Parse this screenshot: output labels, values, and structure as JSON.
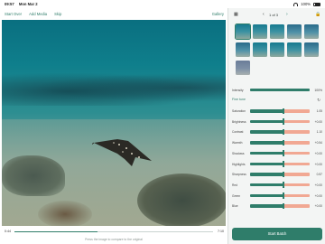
{
  "status": {
    "time": "09:57",
    "date": "Mon Mar 2",
    "battery": "100%"
  },
  "toolbar": {
    "start_over": "Start Over",
    "add_media": "Add Media",
    "skip": "Skip",
    "gallery": "Gallery"
  },
  "player": {
    "current_time": "0:44",
    "duration": "7:10",
    "progress": 0.42,
    "compare_hint": "Press the image to compare to the original"
  },
  "panel": {
    "counter": "1 of 3",
    "intensity": {
      "label": "Intensity",
      "value": "100%",
      "level": 1.0
    },
    "fine_tune": {
      "label": "Fine tune"
    },
    "adjustments": [
      {
        "label": "Saturation",
        "value": "1.05"
      },
      {
        "label": "Brightness",
        "value": "+0.00"
      },
      {
        "label": "Contrast",
        "value": "1.10"
      },
      {
        "label": "Warmth",
        "value": "+0.54"
      },
      {
        "label": "Shadows",
        "value": "+0.00"
      },
      {
        "label": "Highlights",
        "value": "+0.00"
      },
      {
        "label": "Sharpness",
        "value": "0.57"
      },
      {
        "label": "Red",
        "value": "+0.00"
      },
      {
        "label": "Green",
        "value": "+0.00"
      },
      {
        "label": "Blue",
        "value": "+0.00"
      }
    ],
    "start_batch": "Start Batch"
  },
  "icons": {
    "calendar": "calendar-icon",
    "lock": "lock-icon",
    "refresh": "refresh-icon",
    "prev": "chevron-left-icon",
    "next": "chevron-right-icon"
  }
}
